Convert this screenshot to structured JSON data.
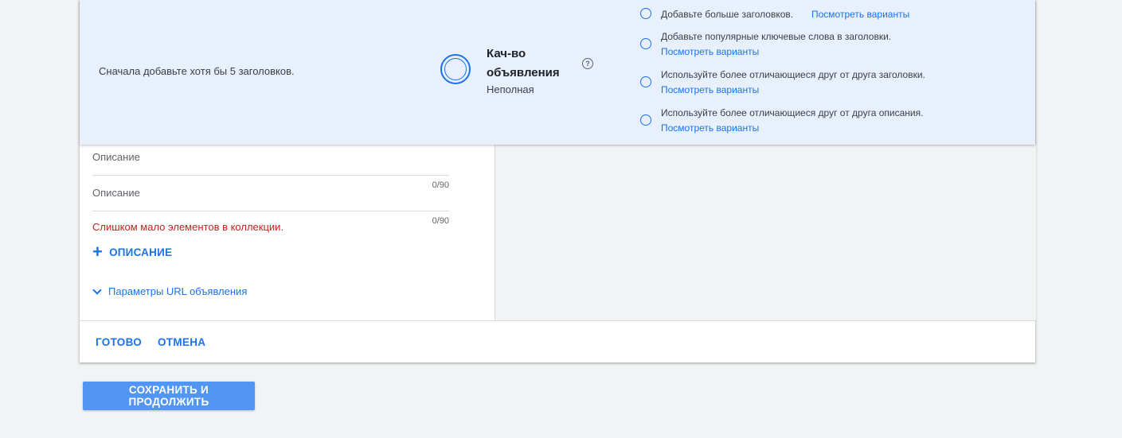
{
  "banner": {
    "hint": "Сначала добавьте хотя бы 5 заголовков.",
    "quality_title": "Кач-во объявления",
    "quality_status": "Неполная",
    "help_glyph": "?",
    "tips": [
      {
        "text": "Добавьте больше заголовков.",
        "link": "Посмотреть варианты"
      },
      {
        "text": "Добавьте популярные ключевые слова в заголовки.",
        "link": "Посмотреть варианты"
      },
      {
        "text": "Используйте более отличающиеся друг от друга заголовки.",
        "link": "Посмотреть варианты"
      },
      {
        "text": "Используйте более отличающиеся друг от друга описания.",
        "link": "Посмотреть варианты"
      }
    ]
  },
  "form": {
    "descriptions": [
      {
        "placeholder": "Описание",
        "counter": "0/90"
      },
      {
        "placeholder": "Описание",
        "counter": "0/90"
      }
    ],
    "error": "Слишком мало элементов в коллекции.",
    "add_description_icon": "+",
    "add_description_label": "ОПИСАНИЕ",
    "url_params_label": "Параметры URL объявления"
  },
  "actions": {
    "done_label": "ГОТОВО",
    "cancel_label": "ОТМЕНА"
  },
  "footer": {
    "save_label": "СОХРАНИТЬ И ПРОДОЛЖИТЬ"
  },
  "colors": {
    "accent": "#1a73e8",
    "banner_bg": "#e8f0fe",
    "error": "#c5221f",
    "save_button": "#5195f5"
  }
}
